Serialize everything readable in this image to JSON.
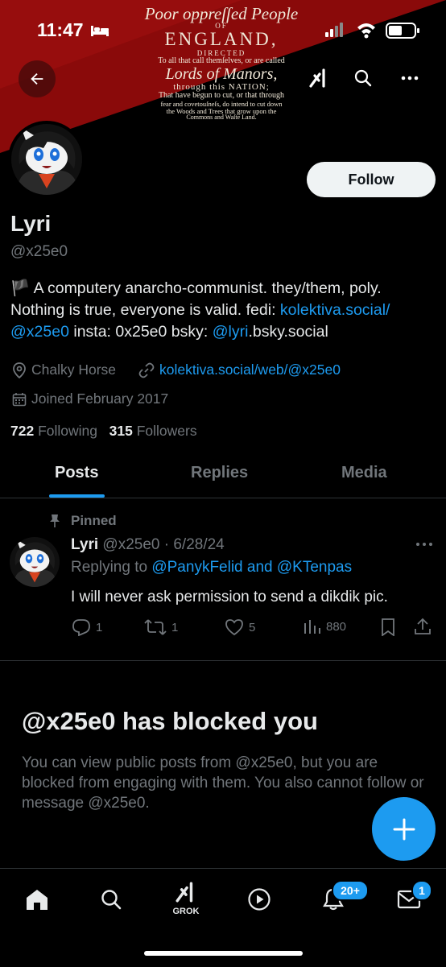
{
  "status_bar": {
    "time": "11:47"
  },
  "banner": {
    "line1": "Poor oppreſſed People",
    "line2": "OF",
    "line3": "ENGLAND,",
    "line4": "DIRECTED",
    "line5": "To all that call themſelves, or are called",
    "line6": "Lords of Manors,",
    "line7": "through this NATION;",
    "line8": "That have begun to cut, or that through",
    "line9": "fear and covetouſneſs, do intend to cut down",
    "line10": "the Woods and Trees that grow upon the",
    "line11": "Commons and Waſte Land."
  },
  "profile": {
    "follow_label": "Follow",
    "name": "Lyri",
    "handle": "@x25e0",
    "bio_flag": "🏴",
    "bio_text_1": " A computery anarcho-communist. they/them, poly. Nothing is true, everyone is valid. fedi: ",
    "bio_link_1": "kolektiva.social/ @x25e0",
    "bio_text_2": " insta: 0x25e0 bsky: ",
    "bio_link_2": "@lyri",
    "bio_text_3": ".bsky.social",
    "location": "Chalky Horse",
    "website": "kolektiva.social/web/@x25e0",
    "joined": "Joined February 2017",
    "following_count": "722",
    "following_label": "Following",
    "followers_count": "315",
    "followers_label": "Followers"
  },
  "tabs": [
    "Posts",
    "Replies",
    "Media"
  ],
  "pinned_post": {
    "pinned_label": "Pinned",
    "author_name": "Lyri",
    "author_handle_date": "@x25e0 · 6/28/24",
    "replying_prefix": "Replying to ",
    "replying_to": "@PanykFelid and @KTenpas",
    "text": "I will never ask permission to send a dikdik pic.",
    "replies": "1",
    "reposts": "1",
    "likes": "5",
    "views": "880"
  },
  "blocked": {
    "title": "@x25e0 has blocked you",
    "body": "You can view public posts from @x25e0, but you are blocked from engaging with them. You also cannot follow or message @x25e0."
  },
  "bottom_nav": {
    "grok_label": "GROK",
    "notifications_badge": "20+",
    "messages_badge": "1"
  },
  "colors": {
    "accent": "#1d9bf0",
    "banner_red": "#8b0000"
  }
}
